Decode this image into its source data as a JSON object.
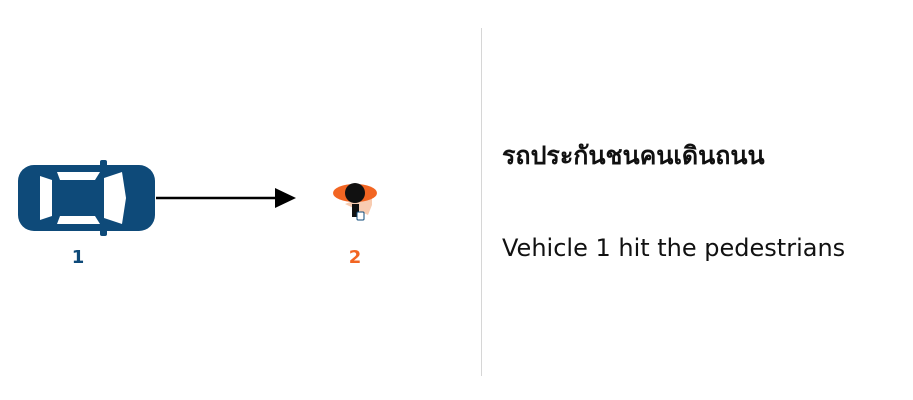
{
  "scene": {
    "vehicle_label": "1",
    "pedestrian_label": "2",
    "colors": {
      "vehicle": "#0e4a79",
      "pedestrian": "#f26522",
      "pedestrian_head": "#111111",
      "arrow": "#000000",
      "divider": "#d6d6d6"
    },
    "icons": [
      "car-icon",
      "arrow-icon",
      "pedestrian-icon"
    ]
  },
  "caption": {
    "thai": "รถประกันชนคนเดินถนน",
    "english": "Vehicle 1 hit the pedestrians"
  }
}
